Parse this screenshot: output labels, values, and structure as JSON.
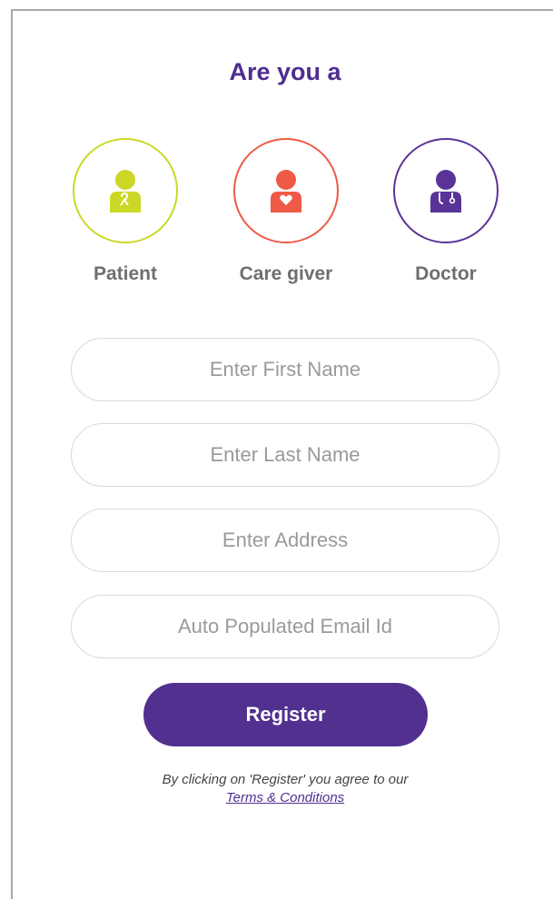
{
  "heading": "Are you a",
  "roles": [
    {
      "label": "Patient",
      "color": "#cbd825",
      "icon": "patient-icon"
    },
    {
      "label": "Care giver",
      "color": "#ee5a47",
      "icon": "caregiver-icon"
    },
    {
      "label": "Doctor",
      "color": "#5a3398",
      "icon": "doctor-icon"
    }
  ],
  "form": {
    "first_name_placeholder": "Enter First Name",
    "last_name_placeholder": "Enter Last Name",
    "address_placeholder": "Enter Address",
    "email_placeholder": "Auto Populated Email Id"
  },
  "register_label": "Register",
  "agreement": {
    "text": "By clicking on 'Register' you agree to our",
    "link": "Terms & Conditions"
  },
  "colors": {
    "primary": "#51308f"
  }
}
